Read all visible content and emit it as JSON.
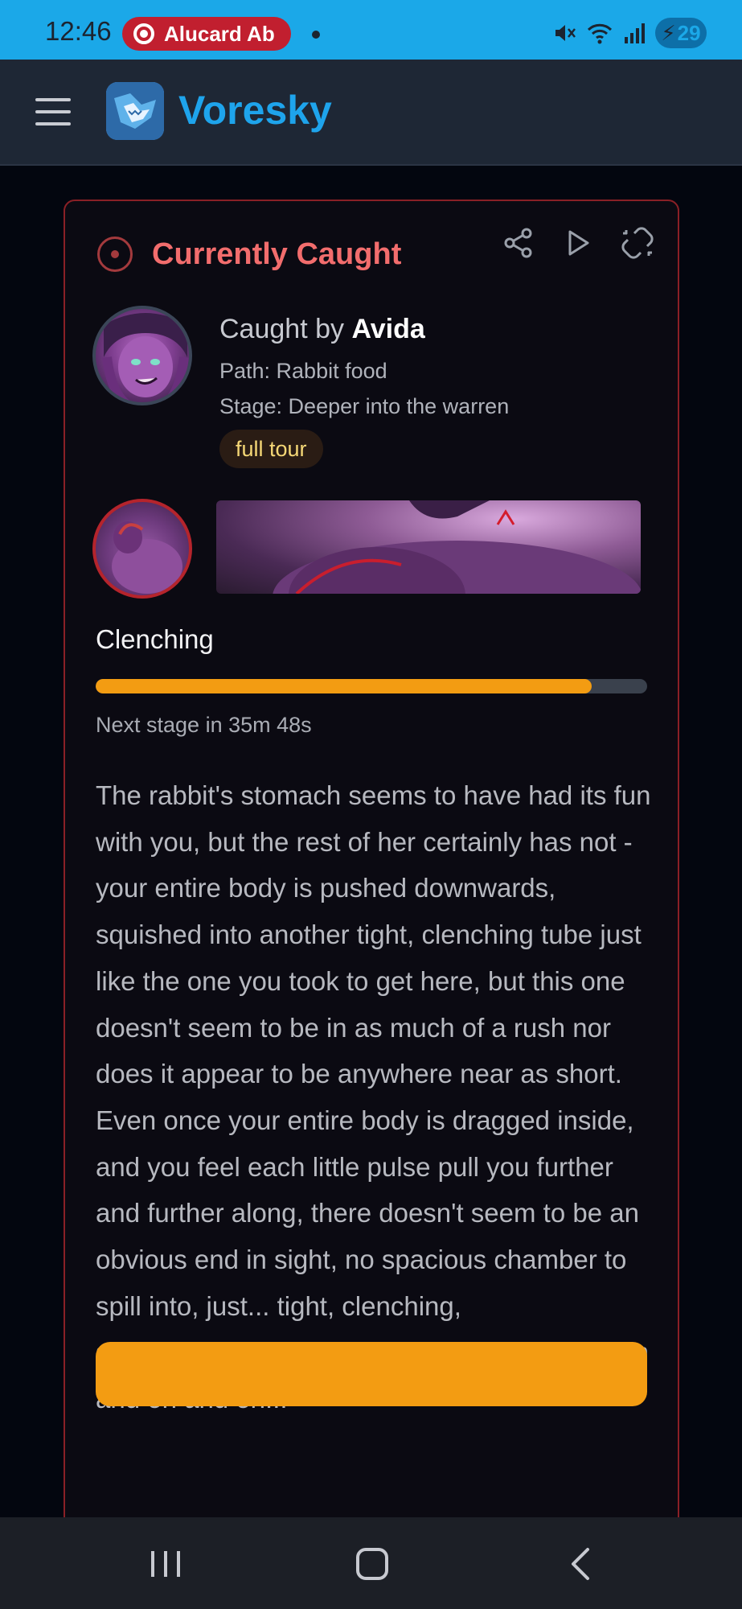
{
  "status_bar": {
    "time": "12:46",
    "recording_label": "Alucard Ab",
    "battery": "29",
    "accent": "#1ba8e8"
  },
  "app": {
    "name": "Voresky",
    "brand_color": "#1ea4ec"
  },
  "card": {
    "title": "Currently Caught",
    "caught_by_prefix": "Caught by",
    "caught_by_name": "Avida",
    "path": "Path: Rabbit food",
    "stage_line": "Stage: Deeper into the warren",
    "badge": "full tour",
    "stage_name": "Clenching",
    "progress_fraction": 0.9,
    "next_stage": "Next stage in 35m 48s",
    "description": "The rabbit's stomach seems to have had its fun with you, but the rest of her certainly has not - your entire body is pushed downwards, squished into another tight, clenching tube just like the one you took to get here, but this one doesn't seem to be in as much of a rush nor does it appear to be anywhere near as short. Even once your entire body is dragged inside, and you feel each little pulse pull you further and further along, there doesn't seem to be an obvious end in sight, no spacious chamber to spill into, just... tight, clenching, squeezing,winding passages that go on and on and on and on...",
    "actions": [
      "share-icon",
      "play-icon",
      "unlink-icon"
    ]
  },
  "icons": {
    "menu": "hamburger-icon",
    "target": "target-icon",
    "nav": [
      "recent-apps-icon",
      "home-icon",
      "back-icon"
    ]
  }
}
